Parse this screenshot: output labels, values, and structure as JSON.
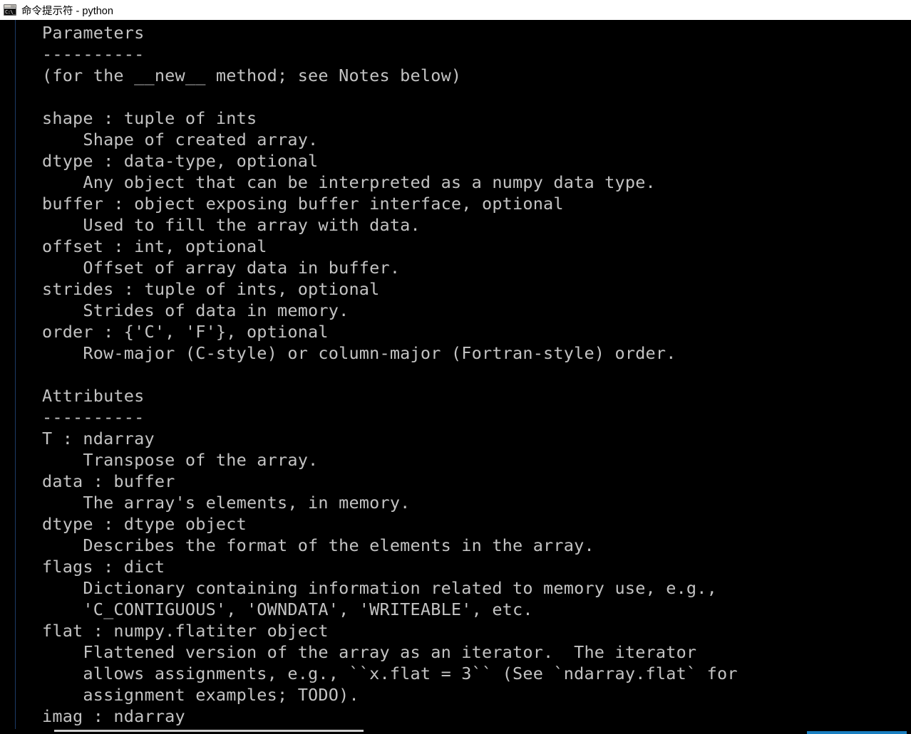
{
  "window": {
    "title": "命令提示符 - python",
    "icon": "cmd-console-icon",
    "icon_glyph": "C:\\_",
    "titlebar_bg": "#ffffff",
    "titlebar_fg": "#000000"
  },
  "console": {
    "background": "#000000",
    "foreground": "#c3c3c3",
    "border_rule_color": "#1c3a66",
    "lines": [
      "Parameters",
      "----------",
      "(for the __new__ method; see Notes below)",
      "",
      "shape : tuple of ints",
      "    Shape of created array.",
      "dtype : data-type, optional",
      "    Any object that can be interpreted as a numpy data type.",
      "buffer : object exposing buffer interface, optional",
      "    Used to fill the array with data.",
      "offset : int, optional",
      "    Offset of array data in buffer.",
      "strides : tuple of ints, optional",
      "    Strides of data in memory.",
      "order : {'C', 'F'}, optional",
      "    Row-major (C-style) or column-major (Fortran-style) order.",
      "",
      "Attributes",
      "----------",
      "T : ndarray",
      "    Transpose of the array.",
      "data : buffer",
      "    The array's elements, in memory.",
      "dtype : dtype object",
      "    Describes the format of the elements in the array.",
      "flags : dict",
      "    Dictionary containing information related to memory use, e.g.,",
      "    'C_CONTIGUOUS', 'OWNDATA', 'WRITEABLE', etc.",
      "flat : numpy.flatiter object",
      "    Flattened version of the array as an iterator.  The iterator",
      "    allows assignments, e.g., ``x.flat = 3`` (See `ndarray.flat` for",
      "    assignment examples; TODO).",
      "imag : ndarray"
    ]
  },
  "scrollbar": {
    "orientation": "horizontal",
    "thumb_color": "#cfcfcf",
    "accent_color": "#1a7fc1"
  }
}
